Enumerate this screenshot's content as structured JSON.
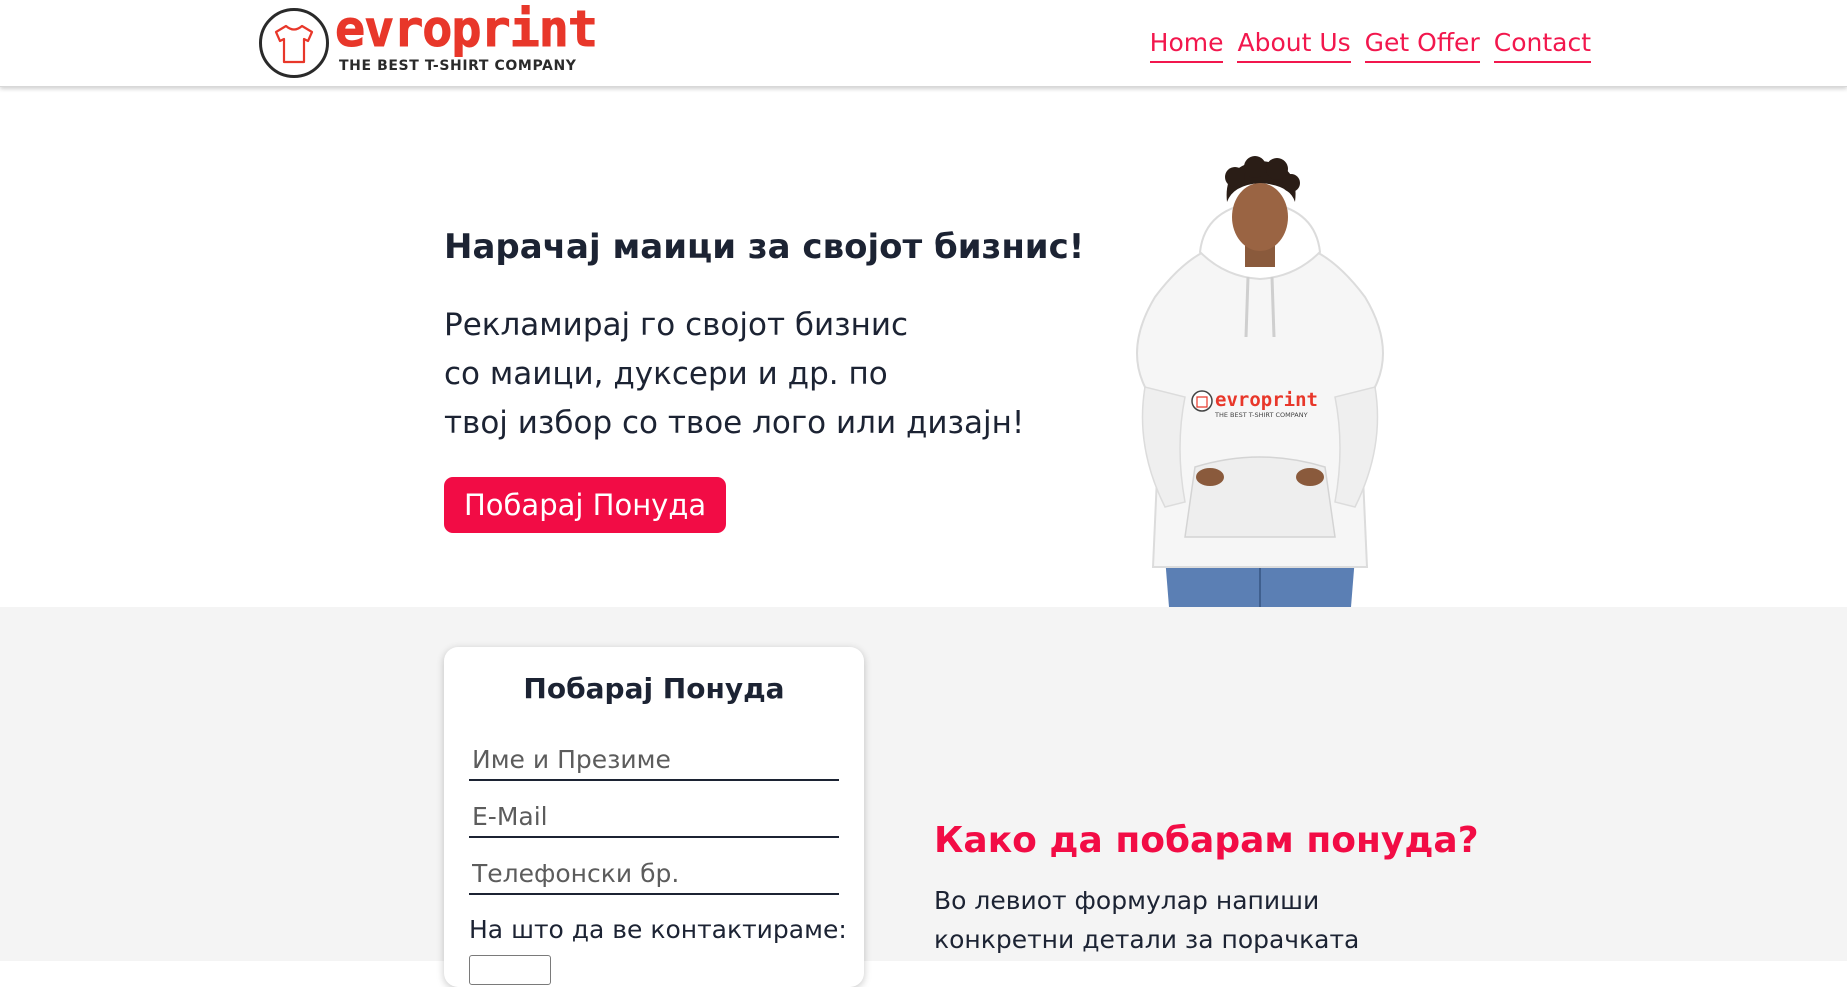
{
  "brand": {
    "name": "evroprint",
    "tagline": "THE BEST T-SHIRT COMPANY",
    "color": "#e8372a"
  },
  "nav": {
    "items": [
      {
        "label": "Home"
      },
      {
        "label": "About Us"
      },
      {
        "label": "Get Offer"
      },
      {
        "label": "Contact"
      }
    ],
    "color": "#f2174d"
  },
  "hero": {
    "title": "Нарачај маици за својот бизнис!",
    "lines": [
      "Рекламирај го својот бизнис",
      "со маици, дуксери и др. по",
      "твој избор со твое лого или дизајн!"
    ],
    "cta_label": "Побарај Понуда",
    "cta_color": "#f20c45"
  },
  "form": {
    "title": "Побарај Понуда",
    "name_placeholder": "Име и Презиме",
    "email_placeholder": "E-Mail",
    "phone_placeholder": "Телефонски бр.",
    "contact_label": "На што да ве контактираме:"
  },
  "how": {
    "title": "Како да побарам понуда?",
    "lines": [
      "Во левиот формулар напиши",
      "конкретни детали за порачката"
    ]
  }
}
